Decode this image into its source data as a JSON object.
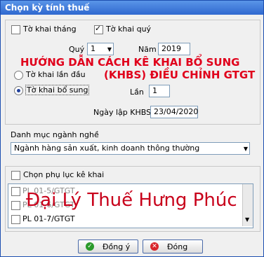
{
  "window": {
    "title": "Chọn kỳ tính thuế"
  },
  "period": {
    "monthly_label": "Tờ khai tháng",
    "quarterly_label": "Tờ khai quý",
    "quarter_label": "Quý",
    "quarter_value": "1",
    "year_label": "Năm",
    "year_value": "2019"
  },
  "declaration": {
    "first_label": "Tờ khai lần đầu",
    "supplement_label": "Tờ khai bổ sung",
    "times_label": "Lần",
    "times_value": "1",
    "date_label": "Ngày lập KHBS",
    "date_value": "23/04/2020"
  },
  "overlay": {
    "line1": "HƯỚNG DẪN CÁCH KÊ KHAI BỔ SUNG",
    "line2": "(KHBS) ĐIỀU CHỈNH GTGT",
    "watermark": "Đại Lý Thuế Hưng Phúc"
  },
  "industry": {
    "label": "Danh mục ngành nghề",
    "selected": "Ngành hàng sản xuất, kinh doanh thông thường"
  },
  "appendix": {
    "label": "Chọn phụ lục kê khai",
    "items": [
      "PL 01-5/GTGT",
      "PL 01-6/GTGT",
      "PL 01-7/GTGT"
    ]
  },
  "buttons": {
    "ok": "Đồng ý",
    "close": "Đóng"
  }
}
